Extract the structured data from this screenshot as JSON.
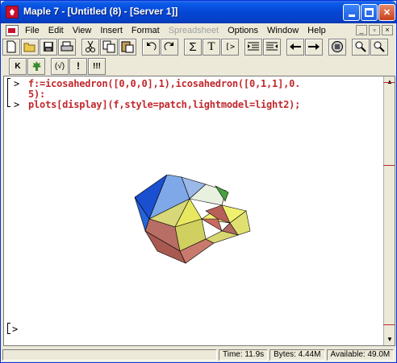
{
  "window": {
    "title": "Maple 7 - [Untitled (8) - [Server 1]]"
  },
  "menu": {
    "items": [
      {
        "label": "File",
        "enabled": true
      },
      {
        "label": "Edit",
        "enabled": true
      },
      {
        "label": "View",
        "enabled": true
      },
      {
        "label": "Insert",
        "enabled": true
      },
      {
        "label": "Format",
        "enabled": true
      },
      {
        "label": "Spreadsheet",
        "enabled": false
      },
      {
        "label": "Options",
        "enabled": true
      },
      {
        "label": "Window",
        "enabled": true
      },
      {
        "label": "Help",
        "enabled": true
      }
    ]
  },
  "toolbar1": {
    "buttons": [
      "new-document",
      "open",
      "save",
      "print",
      "cut",
      "copy",
      "paste",
      "undo",
      "redo",
      "sigma",
      "text",
      "prompt",
      "indent",
      "outdent",
      "back",
      "forward",
      "stop",
      "zoom-out",
      "zoom-in"
    ],
    "labels": {
      "sigma": "Σ",
      "text": "T",
      "prompt": "[>"
    }
  },
  "toolbar2": {
    "labels": {
      "k": "K",
      "sqrt": "(√)",
      "bang": "!",
      "bangs": "!!!"
    }
  },
  "worksheet": {
    "prompt_symbol": ">",
    "input_line1": "f:=icosahedron([0,0,0],1),icosahedron([0,1,1],0.",
    "input_line1_cont": "5):",
    "input_line2": "plots[display](f,style=patch,lightmodel=light2);",
    "empty_prompt": ">"
  },
  "plot": {
    "description_colors": [
      "#2563d8",
      "#7ea8e8",
      "#d8d878",
      "#b86e64",
      "#a85a50",
      "#e8e860",
      "#48a040"
    ]
  },
  "statusbar": {
    "time": "Time: 11.9s",
    "bytes": "Bytes: 4.44M",
    "available": "Available: 49.0M"
  }
}
